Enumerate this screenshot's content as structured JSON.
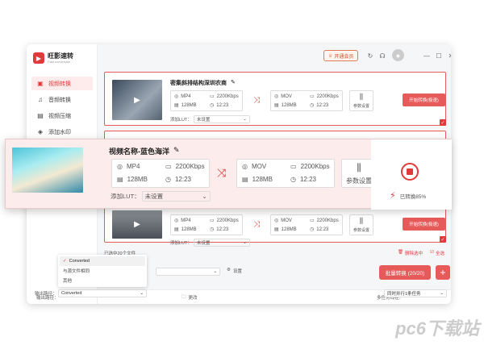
{
  "app": {
    "logo_name": "旺影速转",
    "logo_sub": "Fast conversion"
  },
  "sidebar": {
    "items": [
      {
        "label": "视频转换",
        "active": true
      },
      {
        "label": "音频转换",
        "active": false
      },
      {
        "label": "视频压缩",
        "active": false
      },
      {
        "label": "添加水印",
        "active": false
      }
    ]
  },
  "topbar": {
    "vip_label": "开通会员"
  },
  "cards": [
    {
      "title": "密集斜排结构深圳农商",
      "src_format": "MP4",
      "src_bitrate": "2200Kbps",
      "src_size": "128MB",
      "src_duration": "12:23",
      "dst_format": "MOV",
      "dst_bitrate": "2200Kbps",
      "dst_size": "128MB",
      "dst_duration": "12:23",
      "settings_label": "参数设置",
      "lut_label": "添加LUT：",
      "lut_value": "未设置",
      "start_label": "开始转换(极速)"
    },
    {
      "title": "",
      "src_format": "MP4",
      "src_bitrate": "2200Kbps",
      "src_size": "128MB",
      "src_duration": "12:23",
      "dst_format": "MOV",
      "dst_bitrate": "2200Kbps",
      "dst_size": "128MB",
      "dst_duration": "12:23",
      "settings_label": "参数设置",
      "lut_label": "添加LUT：",
      "lut_value": "未设置",
      "start_label": "开始转换(极速)"
    }
  ],
  "zoom": {
    "title": "视频名称-蓝色海洋",
    "src_format": "MP4",
    "src_bitrate": "2200Kbps",
    "src_size": "128MB",
    "src_duration": "12:23",
    "dst_format": "MOV",
    "dst_bitrate": "2200Kbps",
    "dst_size": "128MB",
    "dst_duration": "12:23",
    "settings_label": "参数设置",
    "lut_label": "添加LUT：",
    "lut_value": "未设置",
    "progress_label": "已转换85%",
    "progress": 0.85
  },
  "footer": {
    "selected_count": "已选中20个文件",
    "delete_selected": "删除选中",
    "select_all": "全选",
    "settings": "设置",
    "output_label": "输出路径：",
    "output_value": "Converted",
    "change": "更改",
    "tasks_label": "多任务线程：",
    "tasks_value": "同时并行1条任务",
    "batch_label": "批量转换 (20/20)",
    "dropdown": [
      "Converted",
      "与源文件相同",
      "其他"
    ]
  },
  "watermark": "pc6下载站",
  "colors": {
    "accent": "#e03a3a"
  }
}
